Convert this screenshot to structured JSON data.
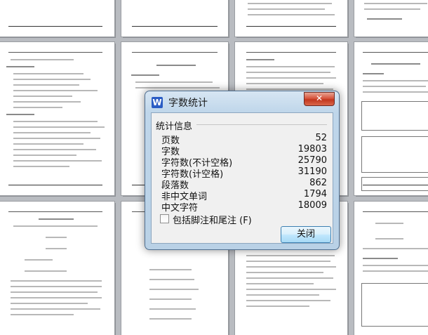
{
  "dialog": {
    "title": "字数统计",
    "app_icon_letter": "W",
    "close_glyph": "✕",
    "group_label": "统计信息",
    "stats": [
      {
        "label": "页数",
        "value": "52"
      },
      {
        "label": "字数",
        "value": "19803"
      },
      {
        "label": "字符数(不计空格)",
        "value": "25790"
      },
      {
        "label": "字符数(计空格)",
        "value": "31190"
      },
      {
        "label": "段落数",
        "value": "862"
      },
      {
        "label": "非中文单词",
        "value": "1794"
      },
      {
        "label": "中文字符",
        "value": "18009"
      }
    ],
    "checkbox_label": "包括脚注和尾注 (F)",
    "checkbox_checked": false,
    "ok_label": "关闭"
  }
}
